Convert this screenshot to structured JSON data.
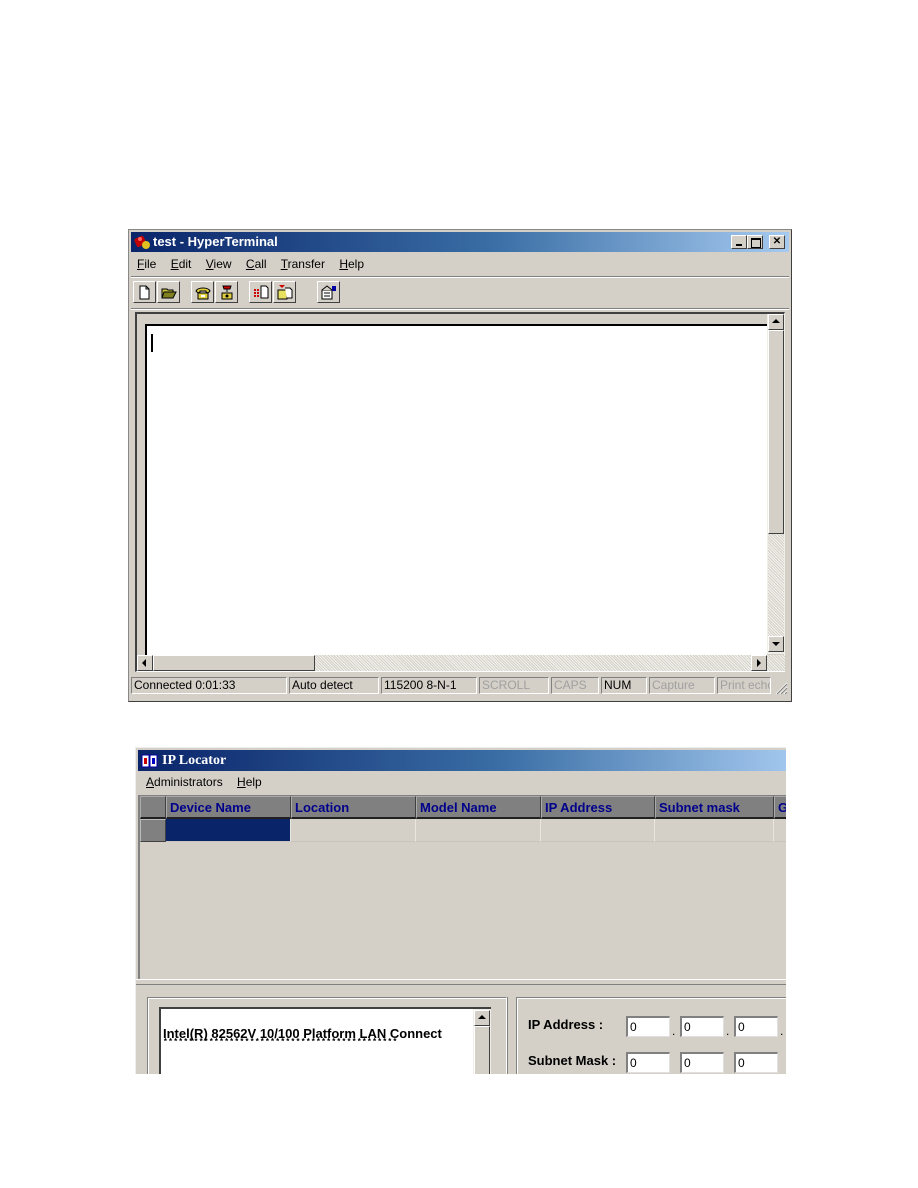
{
  "hyperterminal": {
    "title": "test - HyperTerminal",
    "window_buttons": {
      "minimize": "_",
      "maximize": "□",
      "close": "✕"
    },
    "menu": [
      {
        "label": "File",
        "accel": "F"
      },
      {
        "label": "Edit",
        "accel": "E"
      },
      {
        "label": "View",
        "accel": "V"
      },
      {
        "label": "Call",
        "accel": "C"
      },
      {
        "label": "Transfer",
        "accel": "T"
      },
      {
        "label": "Help",
        "accel": "H"
      }
    ],
    "toolbar": [
      {
        "icon": "new-document-icon"
      },
      {
        "icon": "open-folder-icon"
      },
      {
        "icon": "call-phone-icon"
      },
      {
        "icon": "disconnect-phone-icon"
      },
      {
        "icon": "send-file-icon"
      },
      {
        "icon": "receive-file-icon"
      },
      {
        "icon": "properties-icon"
      }
    ],
    "terminal_text": "",
    "status": {
      "connection": "Connected 0:01:33",
      "emulation": "Auto detect",
      "port_settings": "115200 8-N-1",
      "scroll": "SCROLL",
      "caps": "CAPS",
      "num": "NUM",
      "capture": "Capture",
      "print_echo": "Print echo"
    }
  },
  "ip_locator": {
    "title": "IP Locator",
    "menu": [
      {
        "label": "Administrators",
        "accel": "A"
      },
      {
        "label": "Help",
        "accel": "H"
      }
    ],
    "grid": {
      "columns": [
        "Device Name",
        "Location",
        "Model Name",
        "IP Address",
        "Subnet mask",
        "G"
      ],
      "rows": [
        [
          "",
          "",
          "",
          "",
          "",
          ""
        ]
      ]
    },
    "adapter_list": {
      "adapter_name": "Intel(R) 82562V 10/100 Platform LAN Connect",
      "separator": "**********************************************"
    },
    "settings": {
      "ip_address_label": "IP Address :",
      "subnet_mask_label": "Subnet Mask :",
      "ip_address": [
        "0",
        "0",
        "0"
      ],
      "subnet_mask": [
        "0",
        "0",
        "0"
      ]
    }
  },
  "colors": {
    "title_active_start": "#0a246a",
    "title_active_end": "#a6caf0",
    "face": "#d4d0c8",
    "grid_header_text": "#00008b",
    "selection": "#0a246a"
  }
}
